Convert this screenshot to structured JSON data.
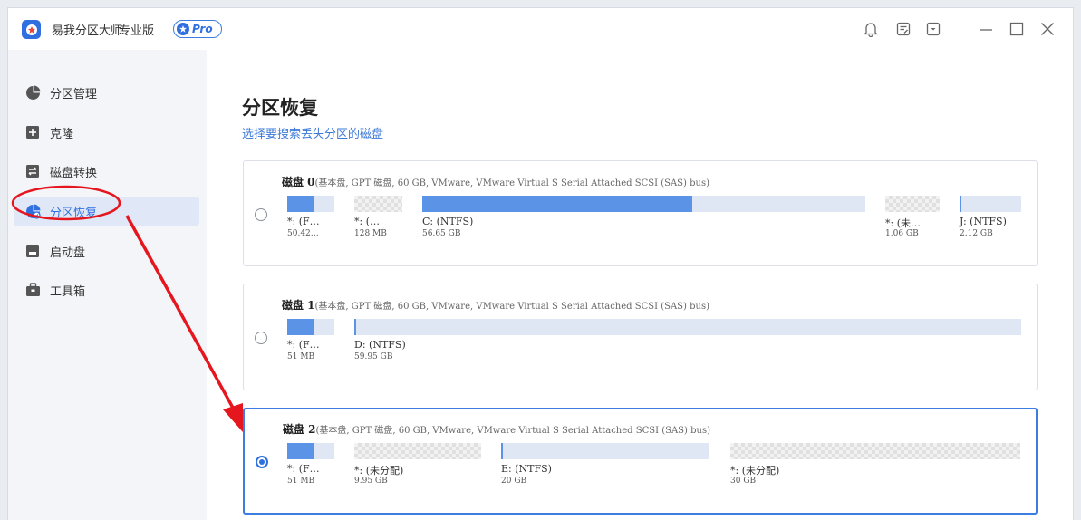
{
  "app": {
    "title": "易我分区大师",
    "edition": "专业版",
    "badge": "Pro",
    "accent": "#2f6fe0"
  },
  "titlebar_icons": [
    "bell-icon",
    "notes-icon",
    "download-icon",
    "minimize-icon",
    "maximize-icon",
    "close-icon"
  ],
  "sidebar": {
    "items": [
      {
        "label": "分区管理",
        "icon": "pie-chart-icon"
      },
      {
        "label": "克隆",
        "icon": "clone-icon"
      },
      {
        "label": "磁盘转换",
        "icon": "convert-icon"
      },
      {
        "label": "分区恢复",
        "icon": "recovery-icon",
        "active": true
      },
      {
        "label": "启动盘",
        "icon": "boot-disk-icon"
      },
      {
        "label": "工具箱",
        "icon": "toolbox-icon"
      }
    ]
  },
  "main": {
    "title": "分区恢复",
    "subtitle": "选择要搜索丢失分区的磁盘",
    "disks": [
      {
        "name": "磁盘 0",
        "info": "(基本盘, GPT 磁盘, 60 GB, VMware,  VMware Virtual S Serial Attached SCSI (SAS) bus)",
        "selected": false,
        "partitions": [
          {
            "label": "*: (F…",
            "size": "50.42…",
            "type": "used",
            "fill": 0.55
          },
          {
            "label": "*: (…",
            "size": "128 MB",
            "type": "unalloc",
            "fill": 0
          },
          {
            "label": "C: (NTFS)",
            "size": "56.65 GB",
            "type": "used",
            "fill": 0.61
          },
          {
            "label": "*: (未…",
            "size": "1.06 GB",
            "type": "unalloc",
            "fill": 0
          },
          {
            "label": "J: (NTFS)",
            "size": "2.12 GB",
            "type": "used",
            "fill": 0.03
          }
        ]
      },
      {
        "name": "磁盘 1",
        "info": "(基本盘, GPT 磁盘, 60 GB, VMware,  VMware Virtual S Serial Attached SCSI (SAS) bus)",
        "selected": false,
        "partitions": [
          {
            "label": "*: (F…",
            "size": "51 MB",
            "type": "used",
            "fill": 0.55
          },
          {
            "label": "D: (NTFS)",
            "size": "59.95 GB",
            "type": "used",
            "fill": 0.003
          }
        ]
      },
      {
        "name": "磁盘 2",
        "info": "(基本盘, GPT 磁盘, 60 GB, VMware,  VMware Virtual S Serial Attached SCSI (SAS) bus)",
        "selected": true,
        "partitions": [
          {
            "label": "*: (F…",
            "size": "51 MB",
            "type": "used",
            "fill": 0.55
          },
          {
            "label": "*: (未分配)",
            "size": "9.95 GB",
            "type": "unalloc",
            "fill": 0
          },
          {
            "label": "E: (NTFS)",
            "size": "20 GB",
            "type": "used",
            "fill": 0.005
          },
          {
            "label": "*: (未分配)",
            "size": "30 GB",
            "type": "unalloc",
            "fill": 0
          }
        ]
      }
    ]
  },
  "annotation_color": "#e5161e"
}
